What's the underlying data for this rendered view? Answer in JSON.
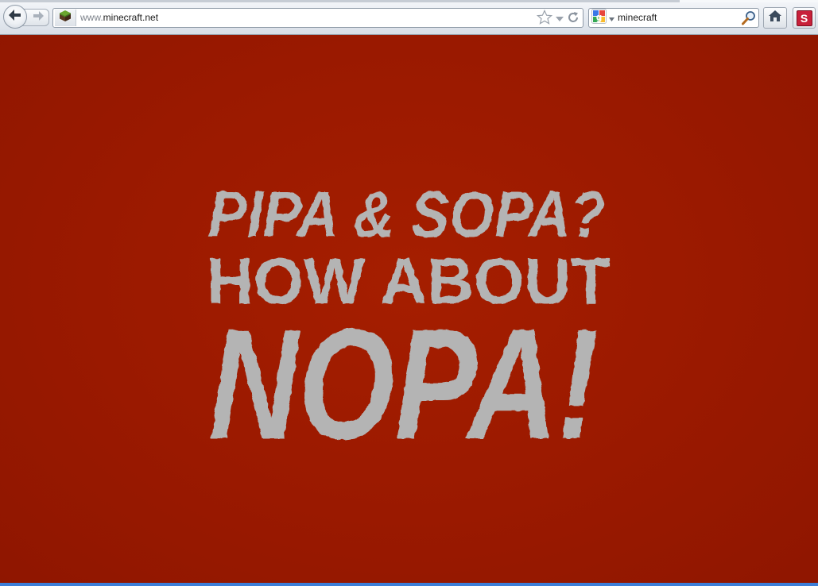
{
  "browser": {
    "url_scheme_prefix": "www.",
    "url_domain": "minecraft.net",
    "search_engine": "google-icon",
    "search_query": "minecraft",
    "addon_badge_letter": "S",
    "icons": {
      "back": "arrow-left-icon",
      "forward": "arrow-right-icon",
      "site": "grass-block-icon",
      "bookmark": "star-icon",
      "history": "dropdown-arrow-icon",
      "reload": "reload-icon",
      "search": "magnifier-icon",
      "home": "home-icon"
    }
  },
  "page": {
    "background_color": "#9b1a00",
    "headline_lines": [
      "PIPA & SOPA?",
      "HOW ABOUT",
      "NOPA!"
    ],
    "headline_color": "#b4b4b4"
  }
}
